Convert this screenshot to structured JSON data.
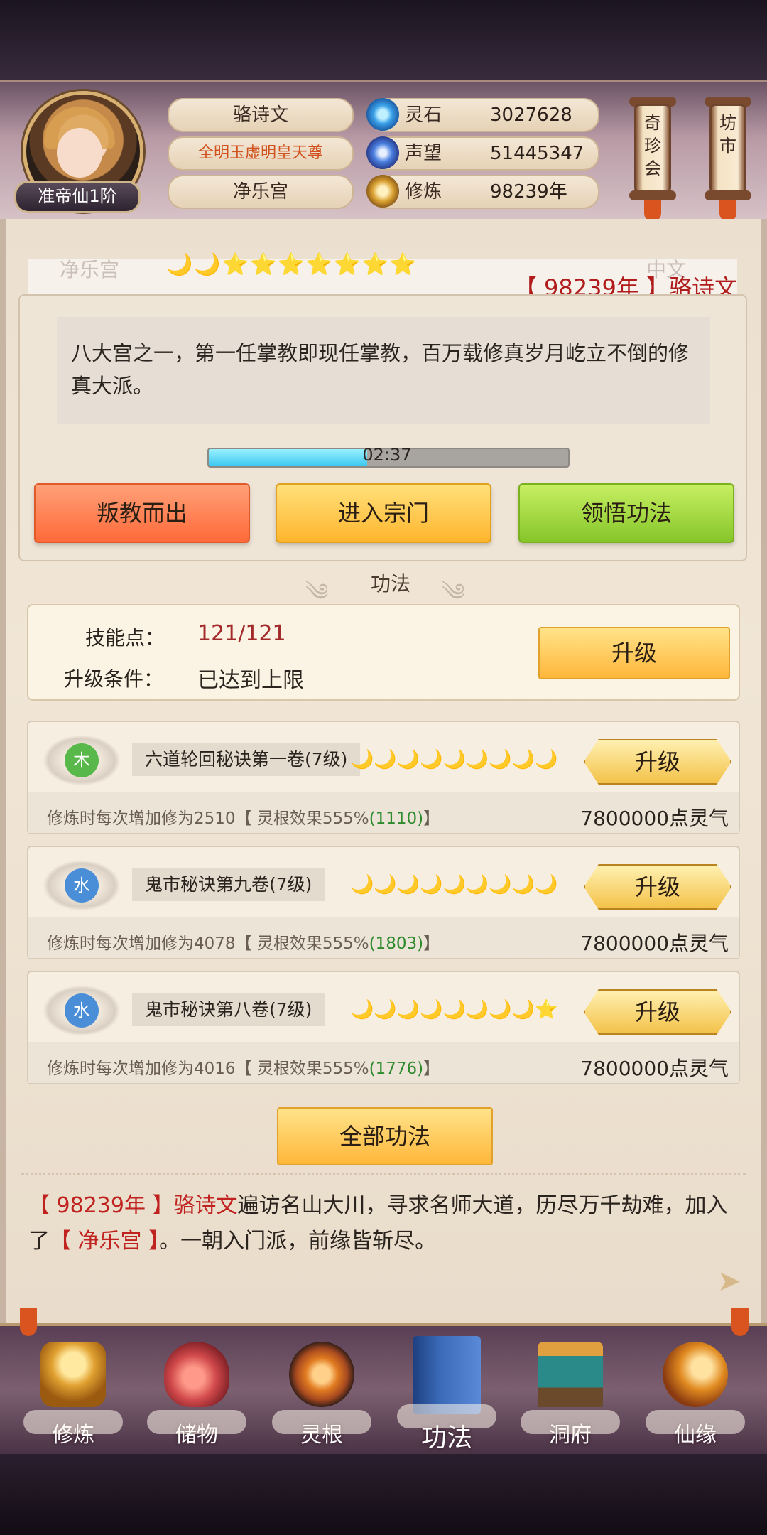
{
  "profile": {
    "rank": "准帝仙1阶",
    "name": "骆诗文",
    "title": "全明玉虚明皇天尊",
    "sect": "净乐宫"
  },
  "resources": [
    {
      "label": "灵石",
      "value": "3027628",
      "icon": "spirit-stone-icon",
      "color": "#3aa0e8"
    },
    {
      "label": "声望",
      "value": "51445347",
      "icon": "reputation-crystal-icon",
      "color": "#4a7fe0"
    },
    {
      "label": "修炼",
      "value": "98239年",
      "icon": "meditation-icon",
      "color": "#d9a030"
    }
  ],
  "side_buttons": [
    {
      "label": "奇珍会"
    },
    {
      "label": "坊市"
    }
  ],
  "sect_panel": {
    "sect_name": "净乐宫",
    "ghost_right": "中文",
    "moons": "🌙🌙⭐⭐⭐⭐⭐⭐⭐",
    "year_line": "【 98239年 】骆诗文",
    "description": "八大宫之一，第一任掌教即现任掌教，百万载修真岁月屹立不倒的修真大派。",
    "timer": "02:37",
    "timer_progress": 0.44,
    "buttons": {
      "defect": "叛教而出",
      "enter": "进入宗门",
      "learn": "领悟功法"
    }
  },
  "gongfa": {
    "title": "功法",
    "skill_points_label": "技能点：",
    "skill_points_value": "121/121",
    "upgrade_cond_label": "升级条件：",
    "upgrade_cond_value": "已达到上限",
    "upgrade_button": "升级"
  },
  "techniques": [
    {
      "element": "木",
      "element_color": "#59b84a",
      "name": "六道轮回秘诀第一卷(7级)",
      "moons": "🌙🌙🌙🌙🌙🌙🌙🌙🌙",
      "effect_prefix": "修炼时每次增加修为2510【 灵根效果555%",
      "effect_green": "(1110)",
      "effect_suffix": "】",
      "cost": "7800000点灵气",
      "button": "升级"
    },
    {
      "element": "水",
      "element_color": "#4a8ed8",
      "name": "鬼市秘诀第九卷(7级)",
      "moons": "🌙🌙🌙🌙🌙🌙🌙🌙🌙",
      "effect_prefix": "修炼时每次增加修为4078【 灵根效果555%",
      "effect_green": "(1803)",
      "effect_suffix": "】",
      "cost": "7800000点灵气",
      "button": "升级"
    },
    {
      "element": "水",
      "element_color": "#4a8ed8",
      "name": "鬼市秘诀第八卷(7级)",
      "moons": "🌙🌙🌙🌙🌙🌙🌙🌙⭐",
      "effect_prefix": "修炼时每次增加修为4016【 灵根效果555%",
      "effect_green": "(1776)",
      "effect_suffix": "】",
      "cost": "7800000点灵气",
      "button": "升级"
    }
  ],
  "all_button": "全部功法",
  "story": {
    "p1": "【 98239年 】",
    "p2": "骆诗文",
    "p3": "遍访名山大川，寻求名师大道，历尽万千劫难，加入了",
    "p4": "【 净乐宫 】",
    "p5": "。一朝入门派，前缘皆斩尽。"
  },
  "nav": [
    {
      "label": "修炼",
      "icon": "meditating-monk-icon",
      "color": "#e0a030"
    },
    {
      "label": "储物",
      "icon": "treasure-bag-icon",
      "color": "#d0484a"
    },
    {
      "label": "灵根",
      "icon": "spirit-root-icon",
      "color": "#a84a20"
    },
    {
      "label": "功法",
      "icon": "technique-book-icon",
      "color": "#3a6ab8"
    },
    {
      "label": "洞府",
      "icon": "cave-mansion-icon",
      "color": "#2a8a8a"
    },
    {
      "label": "仙缘",
      "icon": "gourd-icon",
      "color": "#e08a20"
    }
  ]
}
